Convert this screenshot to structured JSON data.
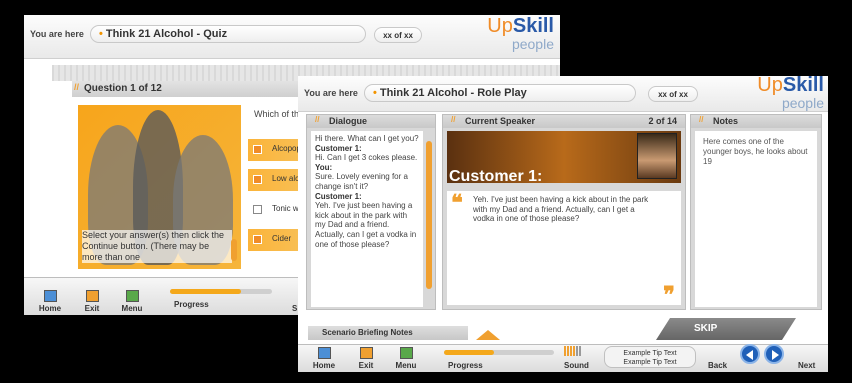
{
  "quiz": {
    "breadcrumb_label": "You are here",
    "title": "Think 21 Alcohol - Quiz",
    "counter": "xx of xx",
    "question_header": "Question 1 of 12",
    "question_text": "Which of the fo",
    "instruction": "Select your answer(s) then click the Continue button. (There may be more than one",
    "options": [
      {
        "label": "Alcopops",
        "selected": true
      },
      {
        "label": "Low alcohol",
        "selected": true
      },
      {
        "label": "Tonic water",
        "selected": false
      },
      {
        "label": "Cider",
        "selected": true
      }
    ],
    "nav": {
      "home": "Home",
      "exit": "Exit",
      "menu": "Menu",
      "progress": "Progress",
      "partial": "S"
    },
    "progress": 0.7
  },
  "roleplay": {
    "breadcrumb_label": "You are here",
    "title": "Think 21 Alcohol - Role Play",
    "counter": "xx of xx",
    "logo": {
      "up": "Up",
      "skill": "Skill",
      "people": "people"
    },
    "dialogue_header": "Dialogue",
    "dialogue": [
      {
        "speaker": "",
        "text": "Hi there. What can I get you?"
      },
      {
        "speaker": "Customer 1:",
        "text": "Hi. Can I get 3 cokes please."
      },
      {
        "speaker": "You:",
        "text": "Sure. Lovely evening for a change isn't it?"
      },
      {
        "speaker": "Customer 1:",
        "text": "Yeh. I've just been having a kick about in the park with my Dad and a friend. Actually, can I get a vodka in one of those please?"
      }
    ],
    "speaker_header": "Current Speaker",
    "speaker_counter": "2 of 14",
    "speaker_name": "Customer 1:",
    "speaker_text": "Yeh. I've just been having a kick about in the park with my Dad and a friend. Actually, can I get a vodka in one of those please?",
    "notes_header": "Notes",
    "notes_text": "Here comes one of the younger boys, he looks about 19",
    "briefing": "Scenario Briefing Notes",
    "skip": "SKIP",
    "nav": {
      "home": "Home",
      "exit": "Exit",
      "menu": "Menu",
      "progress": "Progress",
      "sound": "Sound",
      "back": "Back",
      "next": "Next"
    },
    "tip_line1": "Example Tip Text",
    "tip_line2": "Example Tip Text",
    "progress": 0.45
  }
}
